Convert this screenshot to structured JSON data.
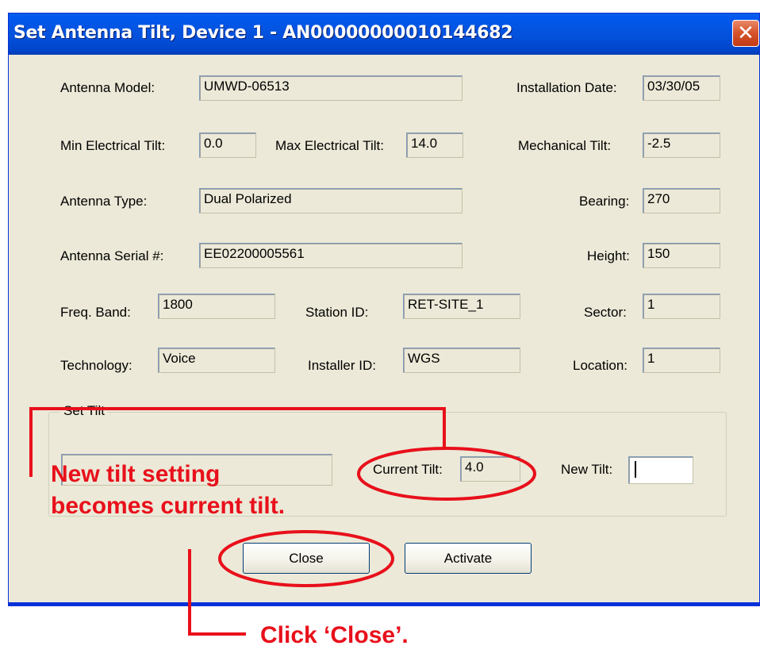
{
  "window": {
    "title": "Set Antenna Tilt, Device 1 - AN00000000010144682",
    "close_glyph": "✕"
  },
  "fields": {
    "antenna_model": {
      "label": "Antenna Model:",
      "value": "UMWD-06513"
    },
    "installation_date": {
      "label": "Installation Date:",
      "value": "03/30/05"
    },
    "min_electrical_tilt": {
      "label": "Min Electrical Tilt:",
      "value": "0.0"
    },
    "max_electrical_tilt": {
      "label": "Max Electrical Tilt:",
      "value": "14.0"
    },
    "mechanical_tilt": {
      "label": "Mechanical Tilt:",
      "value": "-2.5"
    },
    "antenna_type": {
      "label": "Antenna Type:",
      "value": "Dual Polarized"
    },
    "bearing": {
      "label": "Bearing:",
      "value": "270"
    },
    "antenna_serial": {
      "label": "Antenna Serial #:",
      "value": "EE02200005561"
    },
    "height": {
      "label": "Height:",
      "value": "150"
    },
    "freq_band": {
      "label": "Freq. Band:",
      "value": "1800"
    },
    "station_id": {
      "label": "Station ID:",
      "value": "RET-SITE_1"
    },
    "sector": {
      "label": "Sector:",
      "value": "1"
    },
    "technology": {
      "label": "Technology:",
      "value": "Voice"
    },
    "installer_id": {
      "label": "Installer ID:",
      "value": "WGS"
    },
    "location": {
      "label": "Location:",
      "value": "1"
    }
  },
  "set_tilt": {
    "legend": "Set Tilt",
    "status_value": "",
    "current_tilt_label": "Current Tilt:",
    "current_tilt_value": "4.0",
    "new_tilt_label": "New Tilt:",
    "new_tilt_value": ""
  },
  "buttons": {
    "close": "Close",
    "activate": "Activate"
  },
  "annotations": {
    "tilt_note_line1": "New tilt setting",
    "tilt_note_line2": "becomes current tilt.",
    "close_note": "Click ‘Close’."
  },
  "colors": {
    "annotation_red": "#e8101b",
    "title_blue": "#0454e0",
    "dialog_face": "#ece9d8"
  }
}
